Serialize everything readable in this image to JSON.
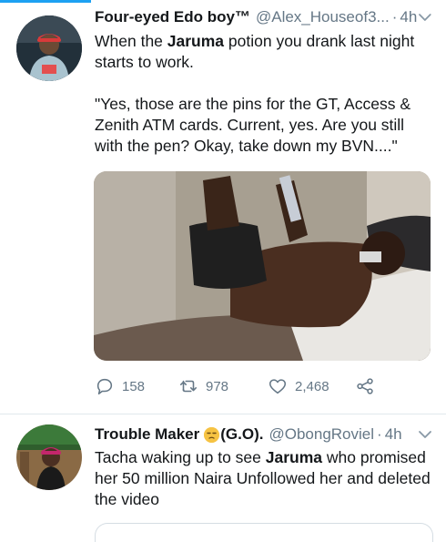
{
  "tweets": [
    {
      "name": "Four-eyed Edo boy™",
      "handle": "@Alex_Houseof3...",
      "separator": "·",
      "time": "4h",
      "body_line1_prefix": "When the ",
      "body_line1_bold": "Jaruma",
      "body_line1_suffix": " potion you drank last night starts to work.",
      "body_paragraph2": "\"Yes, those are the pins for the GT, Access & Zenith ATM cards. Current, yes. Are you still with the pen? Okay, take down my BVN....\"",
      "replies": "158",
      "retweets": "978",
      "likes": "2,468"
    },
    {
      "name": "Trouble Maker",
      "name_suffix": "(G.O).",
      "handle": "@ObongRoviel",
      "separator": "·",
      "time": "4h",
      "body_prefix": "Tacha waking up to see ",
      "body_bold": "Jaruma",
      "body_suffix": " who promised her 50 million Naira Unfollowed her and deleted the video"
    }
  ],
  "colors": {
    "accent": "#1da1f2",
    "text": "#14171a",
    "muted": "#657786"
  },
  "icons": [
    "reply-icon",
    "retweet-icon",
    "like-icon",
    "share-icon",
    "chevron-down-icon",
    "unamused-face-emoji"
  ]
}
